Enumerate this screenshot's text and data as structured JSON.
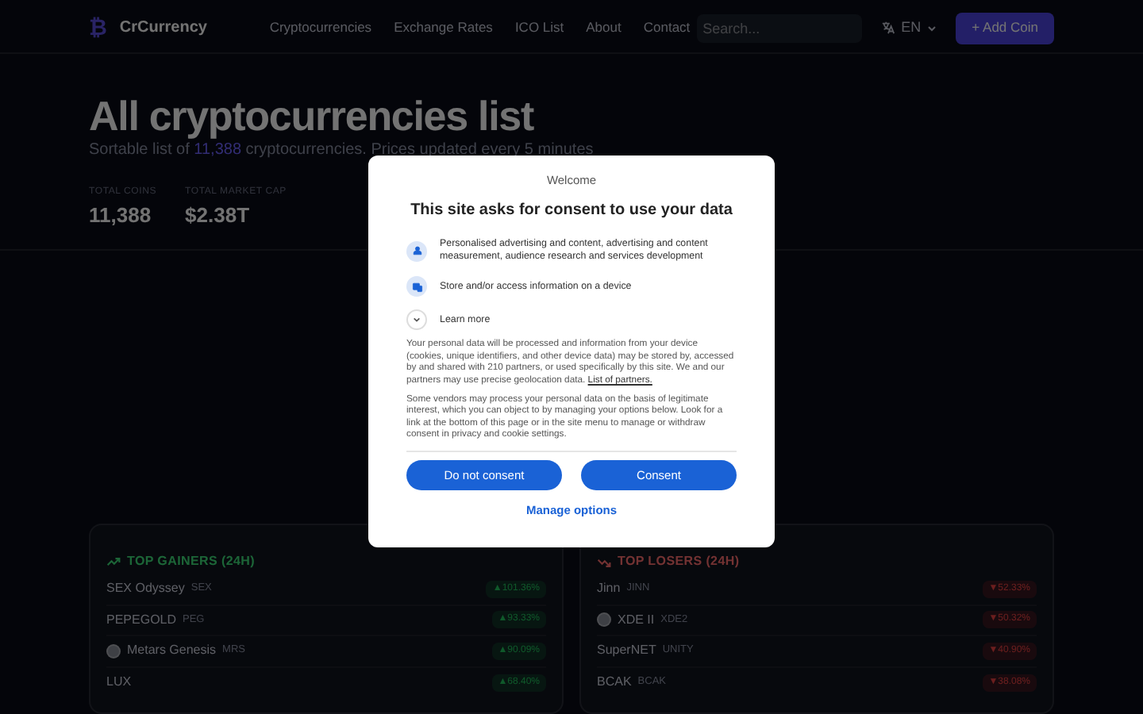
{
  "nav": {
    "logo_glyph": "₿",
    "brand": "CrCurrency",
    "links": [
      "Cryptocurrencies",
      "Exchange Rates",
      "ICO List",
      "About",
      "Contact"
    ],
    "search": {
      "placeholder": "Search..."
    },
    "language": "EN",
    "add_button": "+ Add Coin"
  },
  "hero": {
    "title": "All cryptocurrencies list",
    "subtitle": "Sortable list of **11,388** cryptocurrencies. Prices updated every 5 minutes",
    "stats": [
      {
        "label": "TOTAL COINS",
        "value": "11,388"
      },
      {
        "label": "TOTAL MARKET CAP",
        "value": "$2.38T"
      }
    ]
  },
  "panels": [
    {
      "kind": "gainers",
      "title": "TOP GAINERS (24H)",
      "rows": [
        {
          "kind": "plain",
          "name": "SEX Odyssey",
          "symbol": "SEX",
          "change": "▲101.36%"
        },
        {
          "kind": "plain",
          "name": "PEPEGOLD",
          "symbol": "PEG",
          "change": "▲93.33%"
        },
        {
          "kind": "logo",
          "name": "Metars Genesis",
          "symbol": "MRS",
          "change": "▲90.09%"
        },
        {
          "kind": "plain",
          "name": "LUX",
          "symbol": "",
          "change": "▲68.40%"
        }
      ]
    },
    {
      "kind": "losers",
      "title": "TOP LOSERS (24H)",
      "rows": [
        {
          "kind": "plain",
          "name": "Jinn",
          "symbol": "JINN",
          "change": "▼52.33%"
        },
        {
          "kind": "logo",
          "name": "XDE II",
          "symbol": "XDE2",
          "change": "▼50.32%"
        },
        {
          "kind": "plain",
          "name": "SuperNET",
          "symbol": "UNITY",
          "change": "▼40.90%"
        },
        {
          "kind": "plain",
          "name": "BCAK",
          "symbol": "BCAK",
          "change": "▼38.08%"
        }
      ]
    }
  ],
  "consent": {
    "welcome": "Welcome",
    "heading": "This site asks for consent to use your data",
    "purposes": [
      {
        "kind": "person",
        "text": "Personalised advertising and content, advertising and content measurement, audience research and services development"
      },
      {
        "kind": "device",
        "text": "Store and/or access information on a device"
      }
    ],
    "learn_more": "Learn more",
    "paragraphs": [
      {
        "text": "Your personal data will be processed and information from your device (cookies, unique identifiers, and other device data) may be stored by, accessed by and shared with 210 partners, or used specifically by this site. We and our partners may use precise geolocation data.",
        "link": "List of partners."
      },
      {
        "text": "Some vendors may process your personal data on the basis of legitimate interest, which you can object to by managing your options below. Look for a link at the bottom of this page or in the site menu to manage or withdraw consent in privacy and cookie settings."
      }
    ],
    "buttons": [
      "Do not consent",
      "Consent"
    ],
    "manage": "Manage options"
  }
}
